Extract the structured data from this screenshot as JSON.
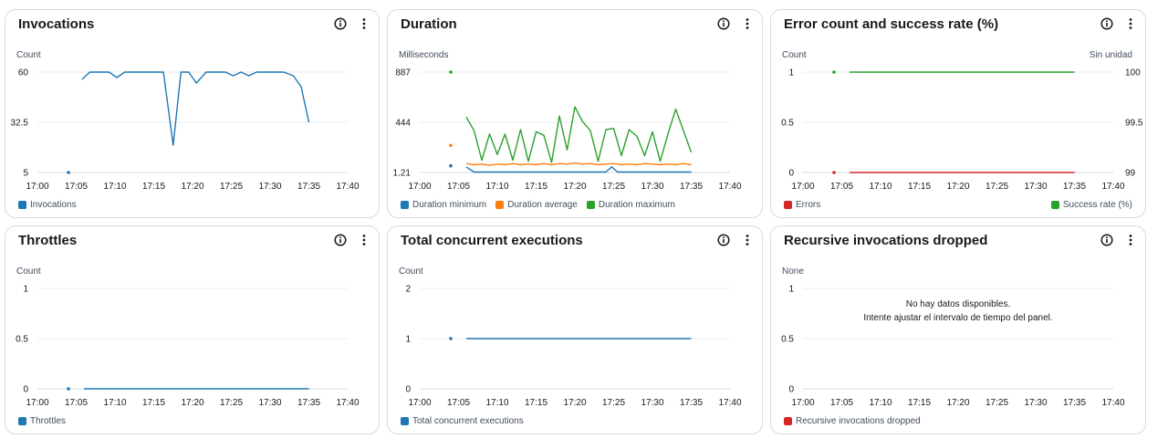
{
  "x_ticks": [
    "17:00",
    "17:05",
    "17:10",
    "17:15",
    "17:20",
    "17:25",
    "17:30",
    "17:35",
    "17:40"
  ],
  "colors": {
    "blue": "#1f77b4",
    "orange": "#ff7f0e",
    "green": "#2ca02c",
    "red": "#d62728"
  },
  "panels": [
    {
      "title": "Invocations",
      "unit_left": "Count",
      "unit_right": "",
      "legend": [
        {
          "label": "Invocations",
          "color": "blue",
          "align": "left"
        }
      ],
      "nodata": []
    },
    {
      "title": "Duration",
      "unit_left": "Milliseconds",
      "unit_right": "",
      "legend": [
        {
          "label": "Duration minimum",
          "color": "blue",
          "align": "left"
        },
        {
          "label": "Duration average",
          "color": "orange",
          "align": "left"
        },
        {
          "label": "Duration maximum",
          "color": "green",
          "align": "left"
        }
      ],
      "nodata": []
    },
    {
      "title": "Error count and success rate (%)",
      "unit_left": "Count",
      "unit_right": "Sin unidad",
      "legend": [
        {
          "label": "Errors",
          "color": "red",
          "align": "left"
        },
        {
          "label": "Success rate (%)",
          "color": "green",
          "align": "right"
        }
      ],
      "nodata": []
    },
    {
      "title": "Throttles",
      "unit_left": "Count",
      "unit_right": "",
      "legend": [
        {
          "label": "Throttles",
          "color": "blue",
          "align": "left"
        }
      ],
      "nodata": []
    },
    {
      "title": "Total concurrent executions",
      "unit_left": "Count",
      "unit_right": "",
      "legend": [
        {
          "label": "Total concurrent executions",
          "color": "blue",
          "align": "left"
        }
      ],
      "nodata": []
    },
    {
      "title": "Recursive invocations dropped",
      "unit_left": "None",
      "unit_right": "",
      "legend": [
        {
          "label": "Recursive invocations dropped",
          "color": "red",
          "align": "left"
        }
      ],
      "nodata": [
        "No hay datos disponibles.",
        "Intente ajustar el intervalo de tiempo del panel."
      ]
    }
  ],
  "chart_data": [
    {
      "type": "line",
      "title": "Invocations",
      "ylabel": "Count",
      "ylim": [
        5,
        60
      ],
      "y_ticks": [
        "60",
        "32.5",
        "5"
      ],
      "x_range": [
        "17:00",
        "17:40"
      ],
      "series": [
        {
          "name": "Invocations",
          "color": "blue",
          "points": [
            [
              "17:04",
              5
            ],
            [
              "17:05:45",
              56
            ],
            [
              "17:06:45",
              60
            ],
            [
              "17:08",
              60
            ],
            [
              "17:09:15",
              60
            ],
            [
              "17:10:15",
              57
            ],
            [
              "17:11:15",
              60
            ],
            [
              "17:12:30",
              60
            ],
            [
              "17:13:45",
              60
            ],
            [
              "17:15",
              60
            ],
            [
              "17:16:15",
              60
            ],
            [
              "17:17:30",
              20
            ],
            [
              "17:18:30",
              60
            ],
            [
              "17:19:30",
              60
            ],
            [
              "17:20:30",
              54
            ],
            [
              "17:21:45",
              60
            ],
            [
              "17:23",
              60
            ],
            [
              "17:24:15",
              60
            ],
            [
              "17:25:15",
              58
            ],
            [
              "17:26:15",
              60
            ],
            [
              "17:27:15",
              58
            ],
            [
              "17:28:15",
              60
            ],
            [
              "17:29:15",
              60
            ],
            [
              "17:30:30",
              60
            ],
            [
              "17:31:45",
              60
            ],
            [
              "17:33",
              58
            ],
            [
              "17:34",
              52
            ],
            [
              "17:35",
              32.5
            ]
          ]
        }
      ]
    },
    {
      "type": "line",
      "title": "Duration",
      "ylabel": "Milliseconds",
      "ylim": [
        1.21,
        887
      ],
      "y_ticks": [
        "887",
        "444",
        "1.21"
      ],
      "x_range": [
        "17:00",
        "17:40"
      ],
      "series": [
        {
          "name": "Duration minimum",
          "color": "blue",
          "points": [
            [
              "17:04",
              60
            ],
            [
              "17:06",
              50
            ],
            [
              "17:07",
              5
            ],
            [
              "17:08",
              5
            ],
            [
              "17:09",
              5
            ],
            [
              "17:10",
              5
            ],
            [
              "17:12",
              5
            ],
            [
              "17:14",
              5
            ],
            [
              "17:16",
              5
            ],
            [
              "17:18",
              5
            ],
            [
              "17:20",
              5
            ],
            [
              "17:22",
              5
            ],
            [
              "17:24",
              5
            ],
            [
              "17:24:45",
              50
            ],
            [
              "17:25:30",
              5
            ],
            [
              "17:27",
              5
            ],
            [
              "17:29",
              5
            ],
            [
              "17:31",
              5
            ],
            [
              "17:33",
              5
            ],
            [
              "17:35",
              5
            ]
          ]
        },
        {
          "name": "Duration average",
          "color": "orange",
          "points": [
            [
              "17:04",
              240
            ],
            [
              "17:06",
              80
            ],
            [
              "17:07",
              70
            ],
            [
              "17:08",
              75
            ],
            [
              "17:09",
              65
            ],
            [
              "17:10",
              75
            ],
            [
              "17:11",
              70
            ],
            [
              "17:12",
              80
            ],
            [
              "17:13",
              70
            ],
            [
              "17:14",
              75
            ],
            [
              "17:15",
              70
            ],
            [
              "17:16",
              80
            ],
            [
              "17:17",
              70
            ],
            [
              "17:18",
              80
            ],
            [
              "17:19",
              75
            ],
            [
              "17:20",
              85
            ],
            [
              "17:21",
              75
            ],
            [
              "17:22",
              80
            ],
            [
              "17:23",
              70
            ],
            [
              "17:24",
              75
            ],
            [
              "17:25",
              80
            ],
            [
              "17:26",
              70
            ],
            [
              "17:27",
              75
            ],
            [
              "17:28",
              70
            ],
            [
              "17:29",
              80
            ],
            [
              "17:30",
              75
            ],
            [
              "17:31",
              70
            ],
            [
              "17:32",
              75
            ],
            [
              "17:33",
              70
            ],
            [
              "17:34",
              80
            ],
            [
              "17:35",
              70
            ]
          ]
        },
        {
          "name": "Duration maximum",
          "color": "green",
          "points": [
            [
              "17:04",
              887
            ],
            [
              "17:06",
              490
            ],
            [
              "17:07",
              370
            ],
            [
              "17:08",
              110
            ],
            [
              "17:09",
              340
            ],
            [
              "17:10",
              160
            ],
            [
              "17:11",
              340
            ],
            [
              "17:12",
              110
            ],
            [
              "17:13",
              380
            ],
            [
              "17:14",
              100
            ],
            [
              "17:15",
              360
            ],
            [
              "17:16",
              330
            ],
            [
              "17:17",
              90
            ],
            [
              "17:18",
              500
            ],
            [
              "17:19",
              200
            ],
            [
              "17:20",
              580
            ],
            [
              "17:21",
              450
            ],
            [
              "17:22",
              370
            ],
            [
              "17:23",
              100
            ],
            [
              "17:24",
              380
            ],
            [
              "17:25",
              390
            ],
            [
              "17:26",
              150
            ],
            [
              "17:27",
              380
            ],
            [
              "17:28",
              320
            ],
            [
              "17:29",
              150
            ],
            [
              "17:30",
              360
            ],
            [
              "17:31",
              100
            ],
            [
              "17:32",
              340
            ],
            [
              "17:33",
              560
            ],
            [
              "17:35",
              180
            ]
          ]
        }
      ]
    },
    {
      "type": "line",
      "title": "Error count and success rate (%)",
      "ylabel": "Count",
      "ylabel_right": "Sin unidad",
      "ylim": [
        0,
        1
      ],
      "ylim_right": [
        99,
        100
      ],
      "y_ticks": [
        "1",
        "0.5",
        "0"
      ],
      "y_ticks_right": [
        "100",
        "99.5",
        "99"
      ],
      "x_range": [
        "17:00",
        "17:40"
      ],
      "series": [
        {
          "name": "Errors",
          "color": "red",
          "axis": "left",
          "points": [
            [
              "17:04",
              0
            ],
            [
              "17:06",
              0
            ],
            [
              "17:35",
              0
            ]
          ]
        },
        {
          "name": "Success rate (%)",
          "color": "green",
          "axis": "right",
          "points": [
            [
              "17:04",
              100
            ],
            [
              "17:06",
              100
            ],
            [
              "17:35",
              100
            ]
          ]
        }
      ]
    },
    {
      "type": "line",
      "title": "Throttles",
      "ylabel": "Count",
      "ylim": [
        0,
        1
      ],
      "y_ticks": [
        "1",
        "0.5",
        "0"
      ],
      "x_range": [
        "17:00",
        "17:40"
      ],
      "series": [
        {
          "name": "Throttles",
          "color": "blue",
          "points": [
            [
              "17:04",
              0
            ],
            [
              "17:06",
              0
            ],
            [
              "17:35",
              0
            ]
          ]
        }
      ]
    },
    {
      "type": "line",
      "title": "Total concurrent executions",
      "ylabel": "Count",
      "ylim": [
        0,
        2
      ],
      "y_ticks": [
        "2",
        "1",
        "0"
      ],
      "x_range": [
        "17:00",
        "17:40"
      ],
      "series": [
        {
          "name": "Total concurrent executions",
          "color": "blue",
          "points": [
            [
              "17:04",
              1
            ],
            [
              "17:06",
              1
            ],
            [
              "17:35",
              1
            ]
          ]
        }
      ]
    },
    {
      "type": "line",
      "title": "Recursive invocations dropped",
      "ylabel": "None",
      "ylim": [
        0,
        1
      ],
      "y_ticks": [
        "1",
        "0.5",
        "0"
      ],
      "x_range": [
        "17:00",
        "17:40"
      ],
      "series": []
    }
  ]
}
